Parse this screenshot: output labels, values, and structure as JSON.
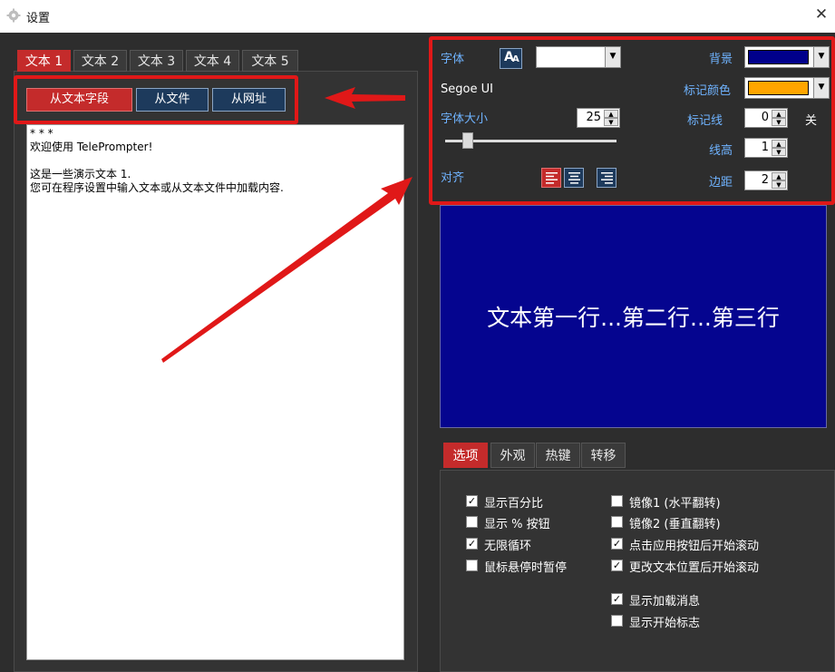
{
  "window": {
    "title": "设置",
    "close_glyph": "✕"
  },
  "text_tabs": [
    "文本 1",
    "文本 2",
    "文本 3",
    "文本 4",
    "文本 5"
  ],
  "source_buttons": {
    "field": "从文本字段",
    "file": "从文件",
    "url": "从网址"
  },
  "editor": {
    "content": "* * *\n欢迎使用 TelePrompter!\n\n这是一些演示文本 1.\n您可在程序设置中输入文本或从文本文件中加载内容."
  },
  "font_settings": {
    "font_label": "字体",
    "font_button_glyph": "A",
    "font_name": "Segoe UI",
    "size_label": "字体大小",
    "size_value": "25",
    "align_label": "对齐",
    "background_label": "背景",
    "marker_color_label": "标记颜色",
    "marker_line_label": "标记线",
    "marker_line_value": "0",
    "marker_line_state": "关",
    "line_height_label": "线高",
    "line_height_value": "1",
    "margin_label": "边距",
    "margin_value": "2",
    "slider_fraction": 0.13,
    "colors": {
      "font": "#ffffff",
      "background": "#00008b",
      "marker": "#ffa500"
    }
  },
  "preview": {
    "text": "文本第一行...第二行...第三行"
  },
  "option_tabs": [
    "选项",
    "外观",
    "热键",
    "转移"
  ],
  "options_left": [
    {
      "label": "显示百分比",
      "checked": true
    },
    {
      "label": "显示 % 按钮",
      "checked": false
    },
    {
      "label": "无限循环",
      "checked": true
    },
    {
      "label": "鼠标悬停时暂停",
      "checked": false
    }
  ],
  "options_right": [
    {
      "label": "镜像1 (水平翻转)",
      "checked": false
    },
    {
      "label": "镜像2 (垂直翻转)",
      "checked": false
    },
    {
      "label": "点击应用按钮后开始滚动",
      "checked": true
    },
    {
      "label": "更改文本位置后开始滚动",
      "checked": true
    }
  ],
  "options_right_extra": [
    {
      "label": "显示加载消息",
      "checked": true
    },
    {
      "label": "显示开始标志",
      "checked": false
    }
  ],
  "icons": {
    "title": "gear-icon",
    "close": "close-icon",
    "font": "font-icon",
    "align": [
      "align-left-icon",
      "align-center-icon",
      "align-right-icon"
    ]
  }
}
